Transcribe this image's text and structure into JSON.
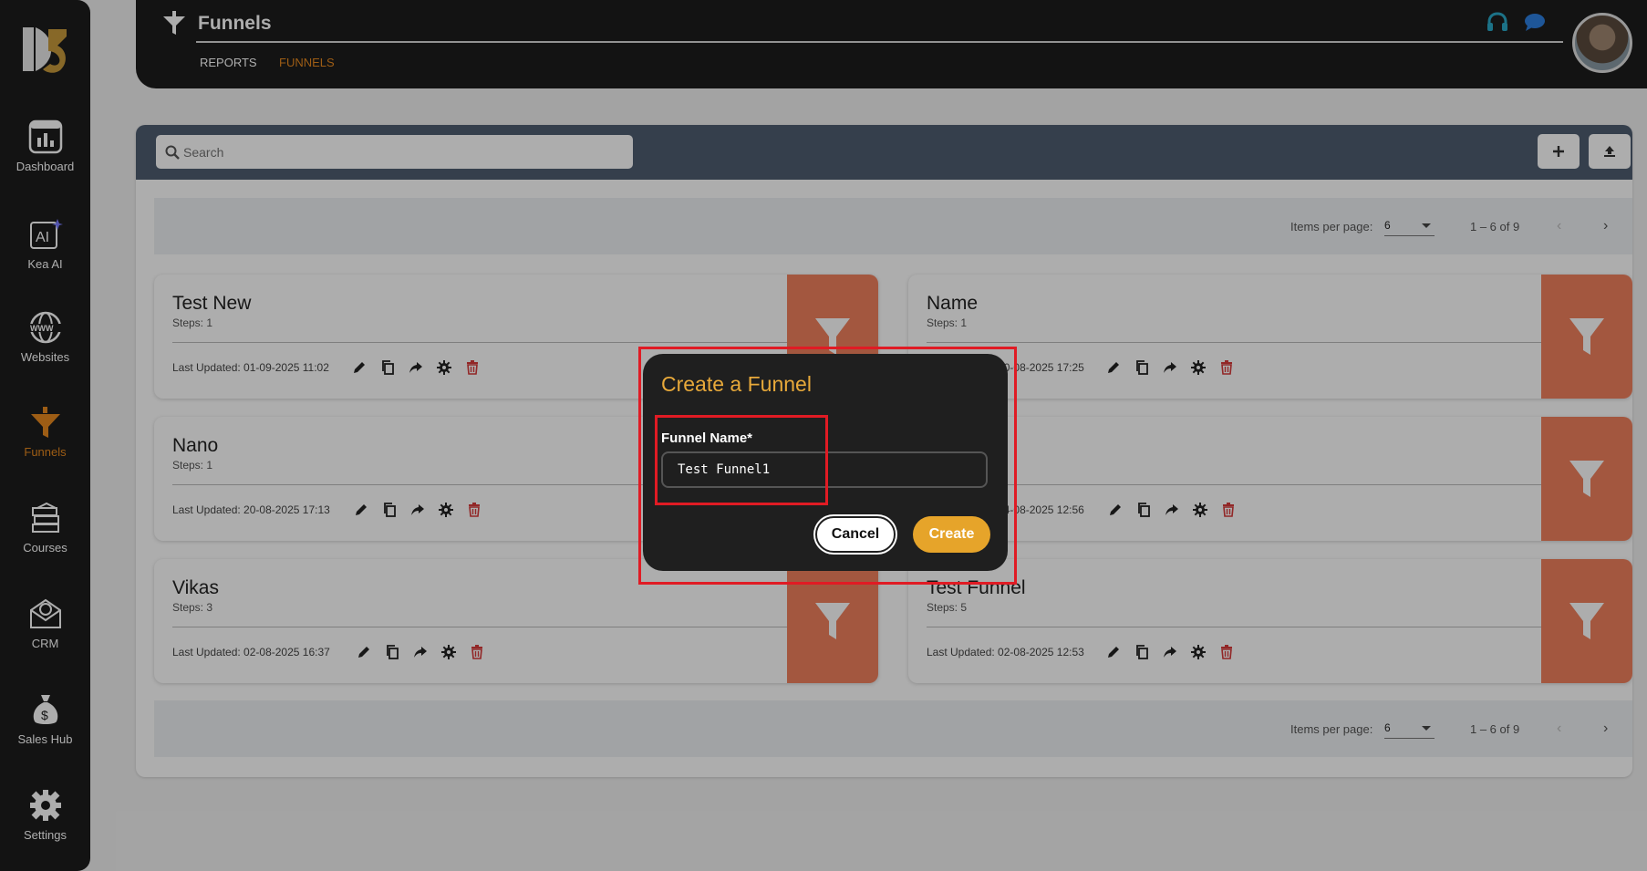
{
  "sidebar": {
    "items": [
      {
        "label": "Dashboard",
        "icon": "dashboard-icon"
      },
      {
        "label": "Kea AI",
        "icon": "ai-icon"
      },
      {
        "label": "Websites",
        "icon": "globe-icon"
      },
      {
        "label": "Funnels",
        "icon": "funnel-icon",
        "active": true
      },
      {
        "label": "Courses",
        "icon": "books-icon"
      },
      {
        "label": "CRM",
        "icon": "envelope-icon"
      },
      {
        "label": "Sales Hub",
        "icon": "moneybag-icon"
      },
      {
        "label": "Settings",
        "icon": "gear-icon"
      }
    ]
  },
  "header": {
    "title": "Funnels",
    "tabs": [
      {
        "label": "REPORTS"
      },
      {
        "label": "FUNNELS",
        "active": true
      }
    ]
  },
  "toolbar": {
    "search_placeholder": "Search"
  },
  "pager": {
    "items_label": "Items per page:",
    "items_value": "6",
    "range": "1 – 6 of 9"
  },
  "cards": [
    {
      "title": "Test New",
      "steps": "Steps: 1",
      "updated": "Last Updated: 01-09-2025 11:02"
    },
    {
      "title": "Name",
      "steps": "Steps: 1",
      "updated": "Last Updated: 20-08-2025 17:25"
    },
    {
      "title": "Nano",
      "steps": "Steps: 1",
      "updated": "Last Updated: 20-08-2025 17:13"
    },
    {
      "title": "",
      "steps": "",
      "updated": "Last Updated: 04-08-2025 12:56"
    },
    {
      "title": "Vikas",
      "steps": "Steps: 3",
      "updated": "Last Updated: 02-08-2025 16:37"
    },
    {
      "title": "Test Funnel",
      "steps": "Steps: 5",
      "updated": "Last Updated: 02-08-2025 12:53"
    }
  ],
  "dialog": {
    "title": "Create a Funnel",
    "field_label": "Funnel Name*",
    "field_value": "Test Funnel1",
    "cancel": "Cancel",
    "create": "Create"
  },
  "colors": {
    "accent": "#e8891f",
    "card_side": "#f0815e",
    "toolbar": "#4f5d70",
    "create_button": "#e6a42a",
    "highlight": "#e01b24"
  }
}
